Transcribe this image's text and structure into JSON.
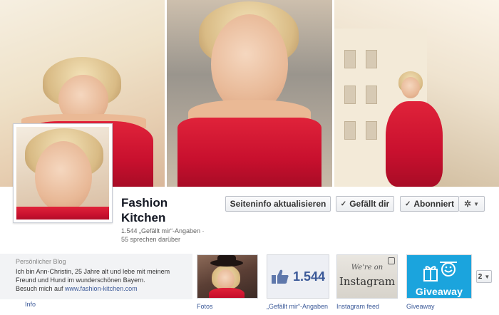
{
  "page": {
    "name": "Fashion Kitchen",
    "stats_likes": "1.544 „Gefällt mir“-Angaben ·",
    "stats_talking": "55 sprechen darüber"
  },
  "actions": {
    "update_info": "Seiteninfo aktualisieren",
    "liked": "Gefällt dir",
    "subscribed": "Abonniert",
    "check_symbol": "✓",
    "gear_symbol": "✲",
    "caret_symbol": "▼"
  },
  "about": {
    "category": "Persönlicher Blog",
    "text": "Ich bin Ann-Christin, 25 Jahre alt und lebe mit meinem Freund und Hund im wunderschönen Bayern.",
    "visit_prefix": "Besuch mich auf ",
    "url": "www.fashion-kitchen.com",
    "info_link": "Info"
  },
  "apps": [
    {
      "label": "Fotos",
      "icon": "photo-thumbnail"
    },
    {
      "label": "„Gefällt mir“-Angaben",
      "icon": "thumbs-up-icon",
      "count": "1.544"
    },
    {
      "label": "Instagram feed",
      "icon": "instagram-icon",
      "line1": "We're on",
      "line2": "Instagram"
    },
    {
      "label": "Giveaway",
      "icon": "gift-icon",
      "text": "Giveaway"
    }
  ],
  "more": {
    "count": "2",
    "caret": "▼"
  },
  "colors": {
    "link": "#3b5998",
    "giveaway_bg": "#1ba4dd",
    "dress_red": "#d0142f"
  }
}
